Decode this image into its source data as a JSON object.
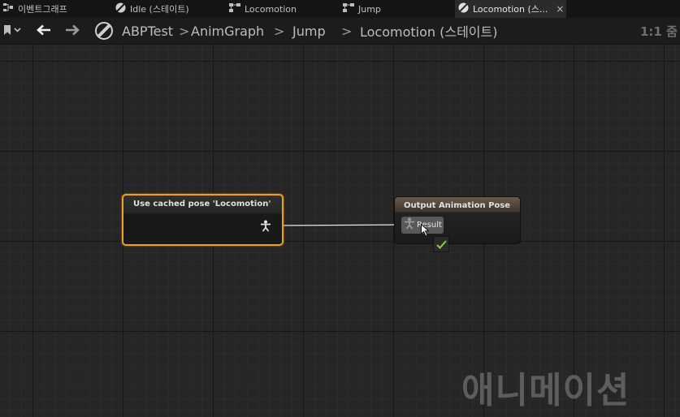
{
  "tabs": [
    {
      "label": "이벤트그래프",
      "icon": "event-graph-icon",
      "active": false
    },
    {
      "label": "Idle (스테이트)",
      "icon": "state-icon",
      "active": false
    },
    {
      "label": "Locomotion",
      "icon": "state-machine-icon",
      "active": false
    },
    {
      "label": "Jump",
      "icon": "state-machine-icon",
      "active": false
    },
    {
      "label": "Locomotion (스...",
      "icon": "state-icon",
      "active": true,
      "close": "×"
    }
  ],
  "toolbar": {
    "breadcrumb": [
      "ABPTest",
      "AnimGraph",
      "Jump",
      "Locomotion (스테이트)"
    ],
    "separator": ">",
    "zoom": "1:1 줌"
  },
  "nodes": {
    "cached_pose": {
      "title": "Use cached pose 'Locomotion'"
    },
    "output_pose": {
      "title": "Output Animation Pose",
      "pin_label": "Result"
    }
  },
  "watermark": "애니메이션",
  "colors": {
    "selection": "#f0a020",
    "canvas": "#262626",
    "check": "#8ccf3f"
  }
}
